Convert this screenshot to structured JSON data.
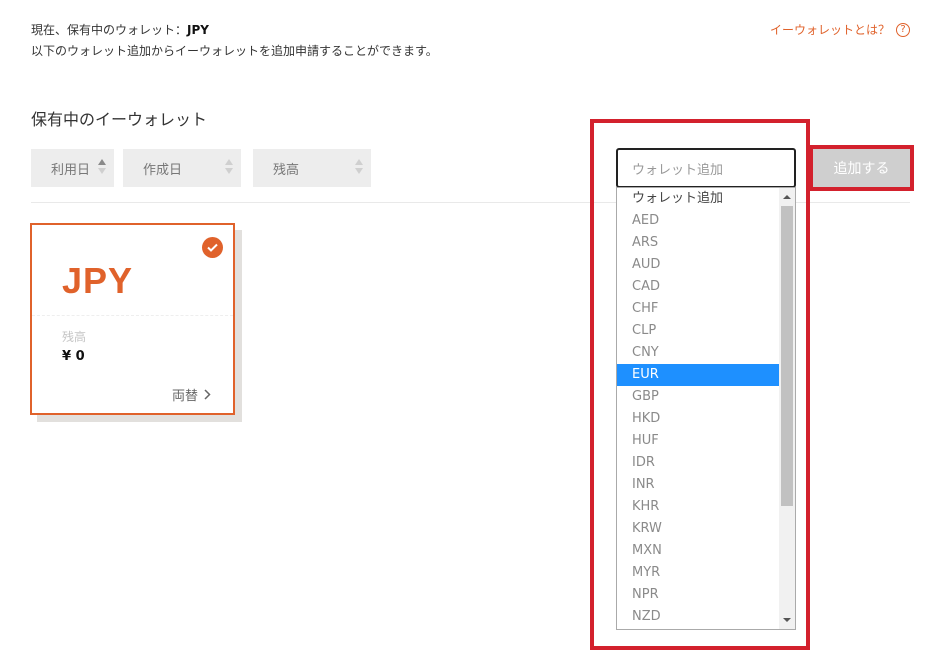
{
  "info": {
    "line1_prefix": "現在、保有中のウォレット：",
    "line1_currency": "JPY",
    "line2": "以下のウォレット追加からイーウォレットを追加申請することができます。"
  },
  "help": {
    "label": "イーウォレットとは？",
    "icon": "question-circle-icon"
  },
  "section_title": "保有中のイーウォレット",
  "sort_buttons": [
    {
      "label": "利用日",
      "active": "up"
    },
    {
      "label": "作成日"
    },
    {
      "label": "残高"
    }
  ],
  "wallet_card": {
    "currency": "JPY",
    "balance_label": "残高",
    "balance_value": "¥ 0",
    "exchange_label": "両替",
    "selected": true
  },
  "wallet_select": {
    "placeholder": "ウォレット追加",
    "options": [
      "ウォレット追加",
      "AED",
      "ARS",
      "AUD",
      "CAD",
      "CHF",
      "CLP",
      "CNY",
      "EUR",
      "GBP",
      "HKD",
      "HUF",
      "IDR",
      "INR",
      "KHR",
      "KRW",
      "MXN",
      "MYR",
      "NPR",
      "NZD"
    ],
    "highlighted": "EUR"
  },
  "add_button": {
    "label": "追加する"
  },
  "colors": {
    "accent": "#e0622b",
    "highlight_border": "#d3212d",
    "selection": "#1e90ff"
  }
}
